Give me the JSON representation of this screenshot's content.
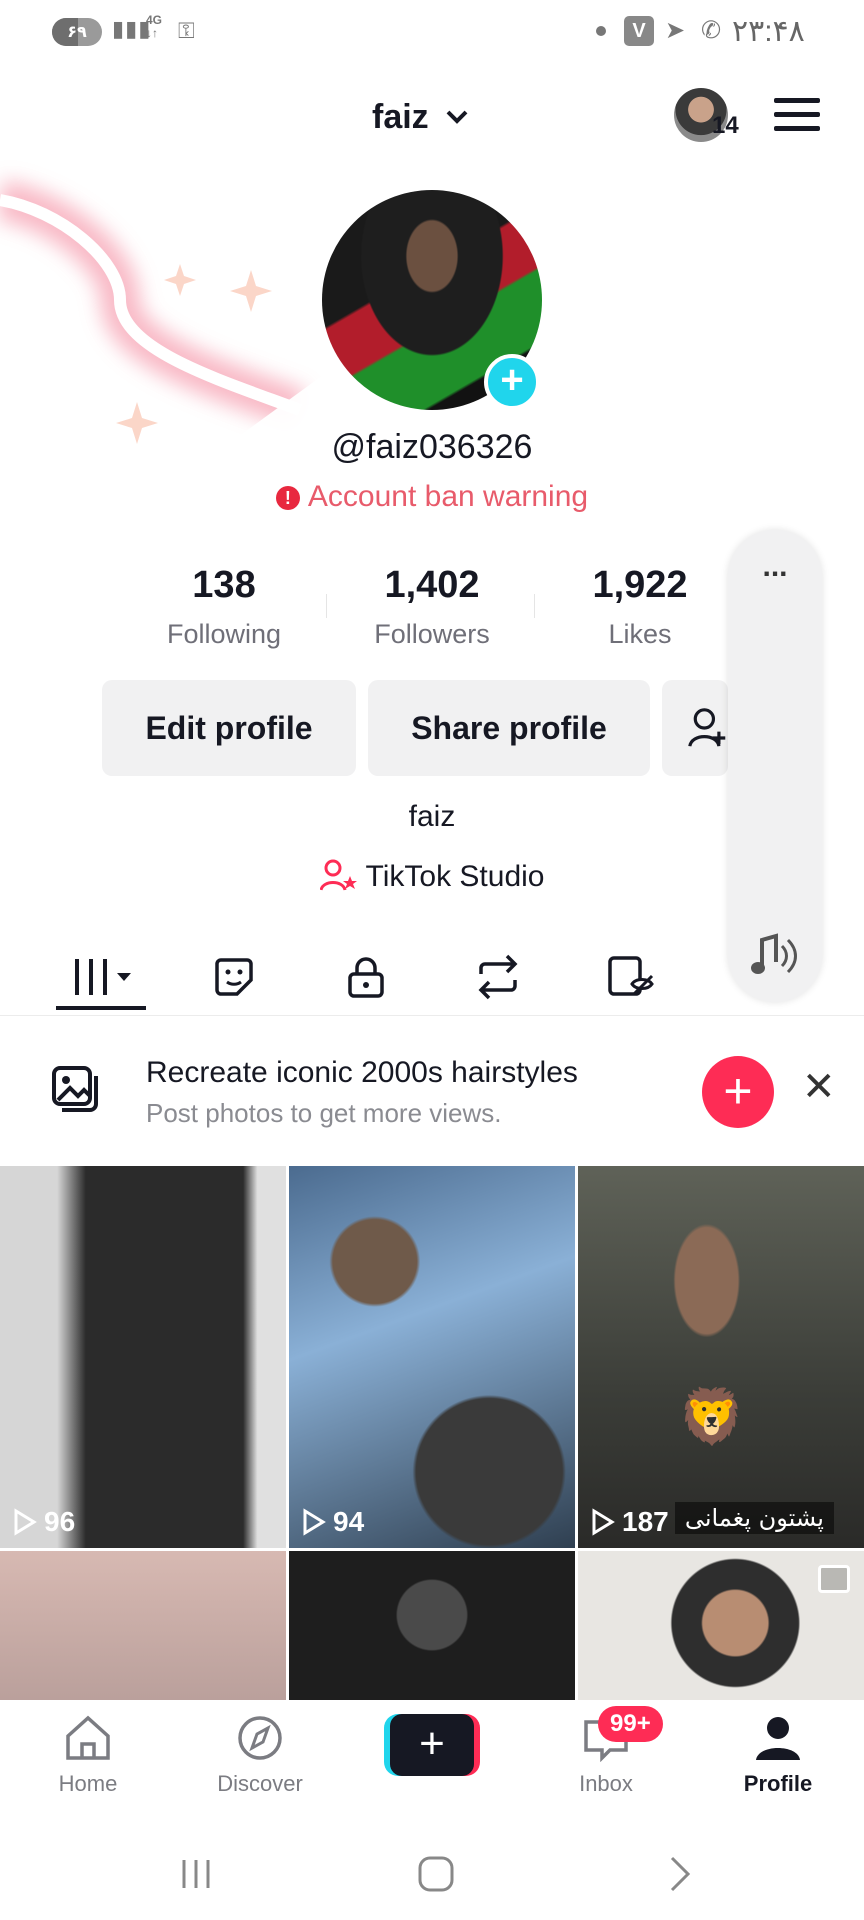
{
  "status_bar": {
    "battery": "۶۹",
    "network": "4G",
    "time": "۲۳:۴۸"
  },
  "header": {
    "username": "faiz",
    "friends_count": "14"
  },
  "profile": {
    "handle": "@faiz036326",
    "warning": "Account ban warning",
    "stats": [
      {
        "value": "138",
        "label": "Following"
      },
      {
        "value": "1,402",
        "label": "Followers"
      },
      {
        "value": "1,922",
        "label": "Likes"
      }
    ],
    "edit_label": "Edit profile",
    "share_label": "Share profile",
    "bio_name": "faiz",
    "studio_label": "TikTok Studio"
  },
  "side_panel": {
    "more_label": "..."
  },
  "promo": {
    "title": "Recreate iconic 2000s hairstyles",
    "subtitle": "Post photos to get more views.",
    "close": "✕",
    "plus": "+"
  },
  "videos": [
    {
      "views": "96"
    },
    {
      "views": "94"
    },
    {
      "views": "187",
      "overlay_text": "پشتون پغمانی"
    },
    {},
    {},
    {}
  ],
  "nav": {
    "home": "Home",
    "discover": "Discover",
    "create": "+",
    "inbox": "Inbox",
    "inbox_badge": "99+",
    "profile": "Profile"
  },
  "colors": {
    "accent": "#fe2c55",
    "cyan": "#20d5ec",
    "warning": "#e85b6b"
  }
}
